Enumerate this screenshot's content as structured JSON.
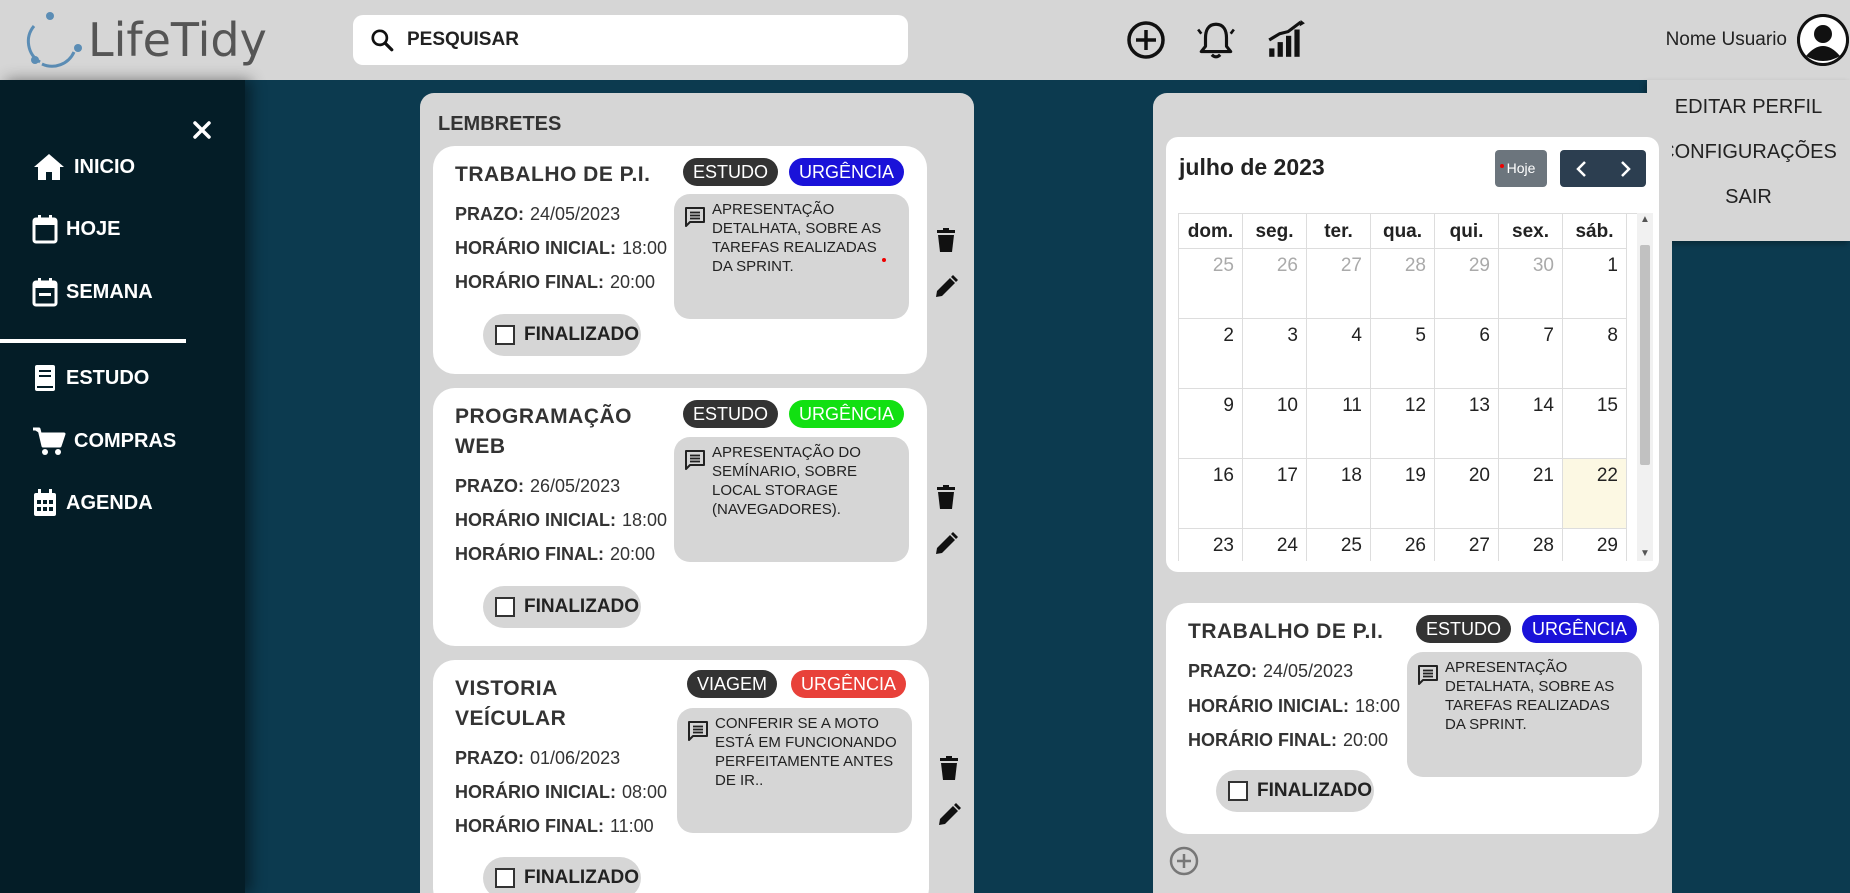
{
  "app": {
    "name": "LifeTidy"
  },
  "search": {
    "placeholder": "PESQUISAR"
  },
  "header": {
    "icons": [
      "add-circle-icon",
      "bell-icon",
      "chart-icon"
    ],
    "user_name": "Nome Usuario"
  },
  "user_menu": {
    "items": [
      "EDITAR PERFIL",
      "CONFIGURAÇÕES",
      "SAIR"
    ]
  },
  "sidebar": {
    "items": [
      {
        "label": "INICIO",
        "icon": "home-icon"
      },
      {
        "label": "HOJE",
        "icon": "calendar-blank-icon"
      },
      {
        "label": "SEMANA",
        "icon": "calendar-week-icon"
      },
      {
        "label": "ESTUDO",
        "icon": "book-icon"
      },
      {
        "label": "COMPRAS",
        "icon": "cart-icon"
      },
      {
        "label": "AGENDA",
        "icon": "calendar-grid-icon"
      }
    ]
  },
  "reminders": {
    "title": "LEMBRETES",
    "labels": {
      "prazo": "PRAZO:",
      "inicio": "HORÁRIO INICIAL:",
      "fim": "HORÁRIO FINAL:",
      "finalizado": "FINALIZADO"
    },
    "items": [
      {
        "title": "TRABALHO DE P.I.",
        "category": "ESTUDO",
        "urgency": "URGÊNCIA",
        "urgency_color": "#1a12d9",
        "prazo": "24/05/2023",
        "inicio": "18:00",
        "fim": "20:00",
        "note": "APRESENTAÇÃO DETALHATA, SOBRE AS TAREFAS REALIZADAS DA SPRINT."
      },
      {
        "title": "PROGRAMAÇÃO WEB",
        "category": "ESTUDO",
        "urgency": "URGÊNCIA",
        "urgency_color": "#12e012",
        "prazo": "26/05/2023",
        "inicio": "18:00",
        "fim": "20:00",
        "note": "APRESENTAÇÃO DO SEMÍNARIO, SOBRE LOCAL STORAGE (NAVEGADORES)."
      },
      {
        "title": "VISTORIA VEÍCULAR",
        "category": "VIAGEM",
        "urgency": "URGÊNCIA",
        "urgency_color": "#e8413a",
        "prazo": "01/06/2023",
        "inicio": "08:00",
        "fim": "11:00",
        "note": "CONFERIR SE A MOTO ESTÁ EM FUNCIONANDO PERFEITAMENTE ANTES DE IR.."
      }
    ]
  },
  "calendar": {
    "title": "julho de 2023",
    "today_label": "Hoje",
    "weekdays": [
      "dom.",
      "seg.",
      "ter.",
      "qua.",
      "qui.",
      "sex.",
      "sáb."
    ],
    "weeks": [
      [
        "25",
        "26",
        "27",
        "28",
        "29",
        "30",
        "1"
      ],
      [
        "2",
        "3",
        "4",
        "5",
        "6",
        "7",
        "8"
      ],
      [
        "9",
        "10",
        "11",
        "12",
        "13",
        "14",
        "15"
      ],
      [
        "16",
        "17",
        "18",
        "19",
        "20",
        "21",
        "22"
      ],
      [
        "23",
        "24",
        "25",
        "26",
        "27",
        "28",
        "29"
      ]
    ],
    "other_month_count_first_week": 6,
    "today": "22"
  },
  "selected_reminder": {
    "title": "TRABALHO DE P.I.",
    "category": "ESTUDO",
    "urgency": "URGÊNCIA",
    "urgency_color": "#1a12d9",
    "prazo": "24/05/2023",
    "inicio": "18:00",
    "fim": "20:00",
    "note": "APRESENTAÇÃO DETALHATA, SOBRE AS TAREFAS REALIZADAS DA SPRINT."
  },
  "colors": {
    "sidebar": "#041d27",
    "background": "#0c3a4f",
    "panel": "#d6d6d6",
    "topbar": "#d6d6d6"
  }
}
